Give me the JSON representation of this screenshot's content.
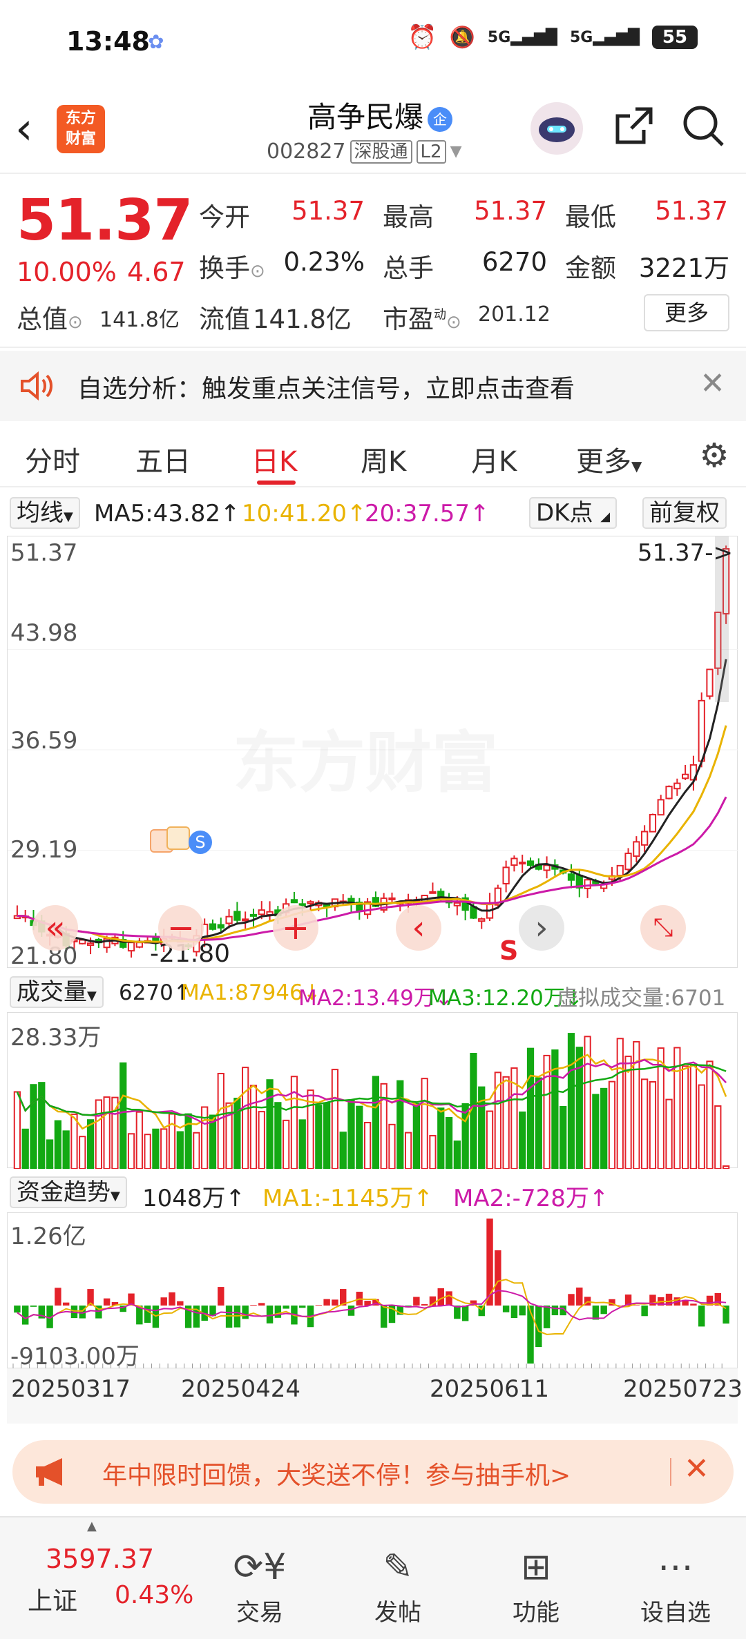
{
  "status_bar": {
    "time": "13:48",
    "network": "5G",
    "battery": "55"
  },
  "header": {
    "app_logo": "东方财富",
    "stock_name": "高争民爆",
    "badge": "企",
    "stock_code": "002827",
    "tag_market": "深股通",
    "tag_level": "L2"
  },
  "quote": {
    "price": "51.37",
    "change_pct": "10.00%",
    "change_amt": "4.67",
    "open_label": "今开",
    "open": "51.37",
    "high_label": "最高",
    "high": "51.37",
    "low_label": "最低",
    "low": "51.37",
    "turnover_label": "换手",
    "turnover": "0.23%",
    "volume_label": "总手",
    "volume": "6270",
    "amount_label": "金额",
    "amount": "3221万",
    "mktcap_label": "总值",
    "mktcap": "141.8亿",
    "float_label": "流值",
    "float": "141.8亿",
    "pe_label": "市盈",
    "pe_sup": "动",
    "pe": "201.12",
    "more_label": "更多"
  },
  "notice": {
    "text": "自选分析：触发重点关注信号，立即点击查看"
  },
  "tabs": [
    "分时",
    "五日",
    "日K",
    "周K",
    "月K",
    "更多"
  ],
  "active_tab": "日K",
  "ma_bar": {
    "selector": "均线",
    "ma5": "MA5:43.82",
    "ma10": "10:41.20",
    "ma20": "20:37.57",
    "dk_label": "DK点",
    "adjust_label": "前复权"
  },
  "kline": {
    "y_labels": [
      "51.37",
      "43.98",
      "36.59",
      "29.19",
      "21.80"
    ],
    "last_price_marker": "51.37->",
    "low_marker": "-21.80",
    "signal_s": "S",
    "watermark": "东方财富"
  },
  "volume_panel": {
    "selector": "成交量",
    "value": "6270",
    "ma1": "MA1:87946",
    "ma2": "MA2:13.49万",
    "ma3": "MA3:12.20万",
    "virtual": "虚拟成交量:6701",
    "y_max": "28.33万"
  },
  "fund_panel": {
    "selector": "资金趋势",
    "value": "1048万",
    "ma1": "MA1:-1145万",
    "ma2": "MA2:-728万",
    "y_max": "1.26亿",
    "y_min": "-9103.00万"
  },
  "x_dates": [
    "20250317",
    "20250424",
    "20250611",
    "20250723"
  ],
  "banner": {
    "text": "年中限时回馈，大奖送不停！参与抽手机>"
  },
  "bottom_nav": {
    "index_value": "3597.37",
    "index_name": "上证",
    "index_change": "0.43%",
    "items": [
      "交易",
      "发帖",
      "功能",
      "设自选"
    ]
  },
  "colors": {
    "up": "#e4222a",
    "down": "#13a913",
    "ma10": "#e9b300",
    "ma20": "#cc1aa8",
    "ma5": "#222222"
  }
}
